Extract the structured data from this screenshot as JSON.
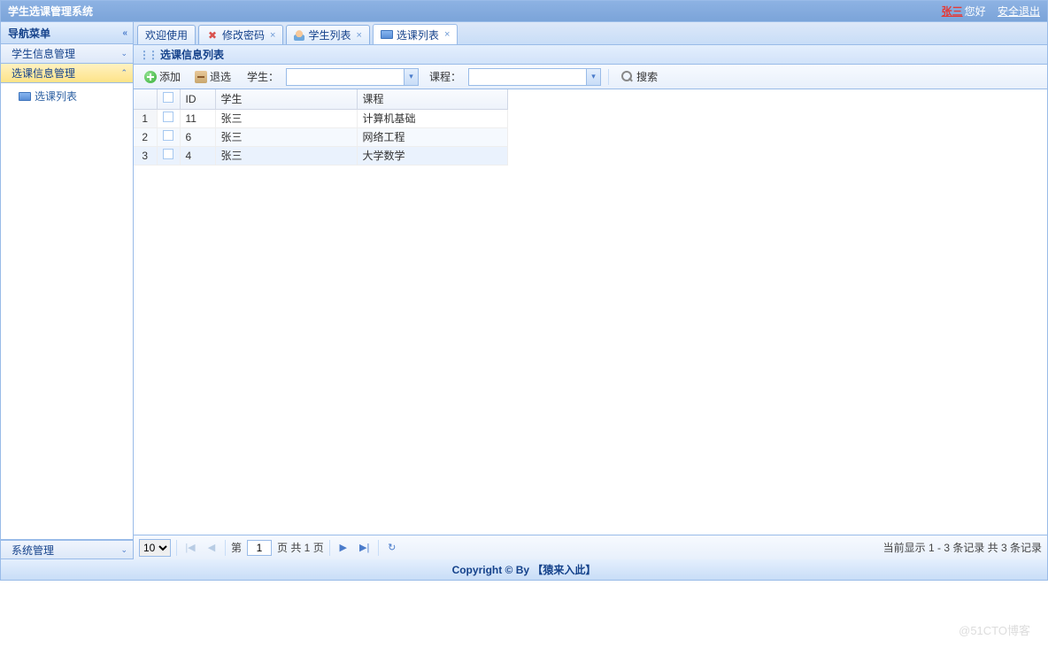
{
  "header": {
    "title": "学生选课管理系统",
    "username": "张三",
    "greeting": "您好",
    "logout": "安全退出"
  },
  "sidebar": {
    "title": "导航菜单",
    "sections": [
      {
        "label": "学生信息管理"
      },
      {
        "label": "选课信息管理"
      },
      {
        "label": "系统管理"
      }
    ],
    "tree_item": "选课列表"
  },
  "tabs": [
    {
      "label": "欢迎使用",
      "closable": false
    },
    {
      "label": "修改密码",
      "closable": true
    },
    {
      "label": "学生列表",
      "closable": true
    },
    {
      "label": "选课列表",
      "closable": true,
      "active": true
    }
  ],
  "panel": {
    "title": "选课信息列表"
  },
  "toolbar": {
    "add": "添加",
    "del": "退选",
    "stu_label": "学生：",
    "course_label": "课程：",
    "search": "搜索"
  },
  "grid": {
    "headers": {
      "id": "ID",
      "student": "学生",
      "course": "课程"
    },
    "rows": [
      {
        "n": "1",
        "id": "11",
        "student": "张三",
        "course": "计算机基础"
      },
      {
        "n": "2",
        "id": "6",
        "student": "张三",
        "course": "网络工程"
      },
      {
        "n": "3",
        "id": "4",
        "student": "张三",
        "course": "大学数学"
      }
    ]
  },
  "pager": {
    "size": "10",
    "page_prefix": "第",
    "page": "1",
    "page_suffix": "页 共 1 页",
    "info": "当前显示 1 - 3 条记录 共 3 条记录"
  },
  "footer": "Copyright © By 【猿来入此】",
  "watermark": "@51CTO博客"
}
